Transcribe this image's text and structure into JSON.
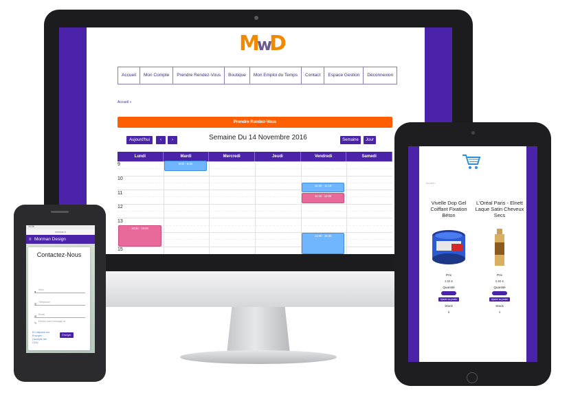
{
  "desktop": {
    "logo": {
      "part1": "M",
      "part2": "D"
    },
    "nav": [
      "Accueil",
      "Mon Compte",
      "Prendre Rendez-Vous",
      "Boutique",
      "Mon Emploi du Temps",
      "Contact",
      "Espace Gestion",
      "Déconnexion"
    ],
    "breadcrumb": "Accueil »",
    "banner": "Prendre Rendez-Vous",
    "calendar": {
      "today_label": "Aujourd'hui",
      "prev_label": "‹",
      "next_label": "›",
      "title": "Semaine Du 14 Novembre 2016",
      "week_label": "Semaine",
      "day_label": "Jour",
      "days": [
        "Lundi",
        "Mardi",
        "Mercredi",
        "Jeudi",
        "Vendredi",
        "Samedi"
      ],
      "hours": [
        "9",
        "10",
        "11",
        "12",
        "13",
        "15"
      ],
      "events": [
        {
          "text": "9:00 - 9:45",
          "color": "blue"
        },
        {
          "text": "10:30 - 11:15",
          "color": "blue"
        },
        {
          "text": "11:15 - 12:00",
          "color": "pink"
        },
        {
          "text": "13:30 - 15:00",
          "color": "pink"
        },
        {
          "text": "14:00 - 15:30",
          "color": "blue"
        }
      ]
    }
  },
  "mobile": {
    "status": "10:26",
    "url": "morman.fr",
    "app_title": "Morman Design",
    "heading": "Contactez-Nous",
    "fields": [
      "Nom",
      "Téléphone",
      "Email",
      "Entrez votre message ici"
    ],
    "note": "En cliquant sur Envoyer, j'accepte les CGU",
    "send_label": "Envoyer"
  },
  "tablet": {
    "breadcrumb": "Accueil »",
    "products": [
      {
        "name": "Vivelle Dop Gel Coiffant Fixation Béton",
        "price_label": "Prix",
        "price": "3.50 €",
        "qty_label": "Quantité",
        "add_label": "Ajouter au panier",
        "stock_label": "Stock",
        "stock": "5"
      },
      {
        "name": "L'Oréal Paris - Elnett Laque Satin Cheveux Secs",
        "price_label": "Prix",
        "price": "5.50 €",
        "qty_label": "Quantité",
        "add_label": "Ajouter au panier",
        "stock_label": "Stock",
        "stock": "4"
      }
    ]
  },
  "colors": {
    "brand": "#4a23a8",
    "accent": "#ff5f00",
    "event_blue": "#6fb6ff",
    "event_pink": "#e86a9a"
  }
}
